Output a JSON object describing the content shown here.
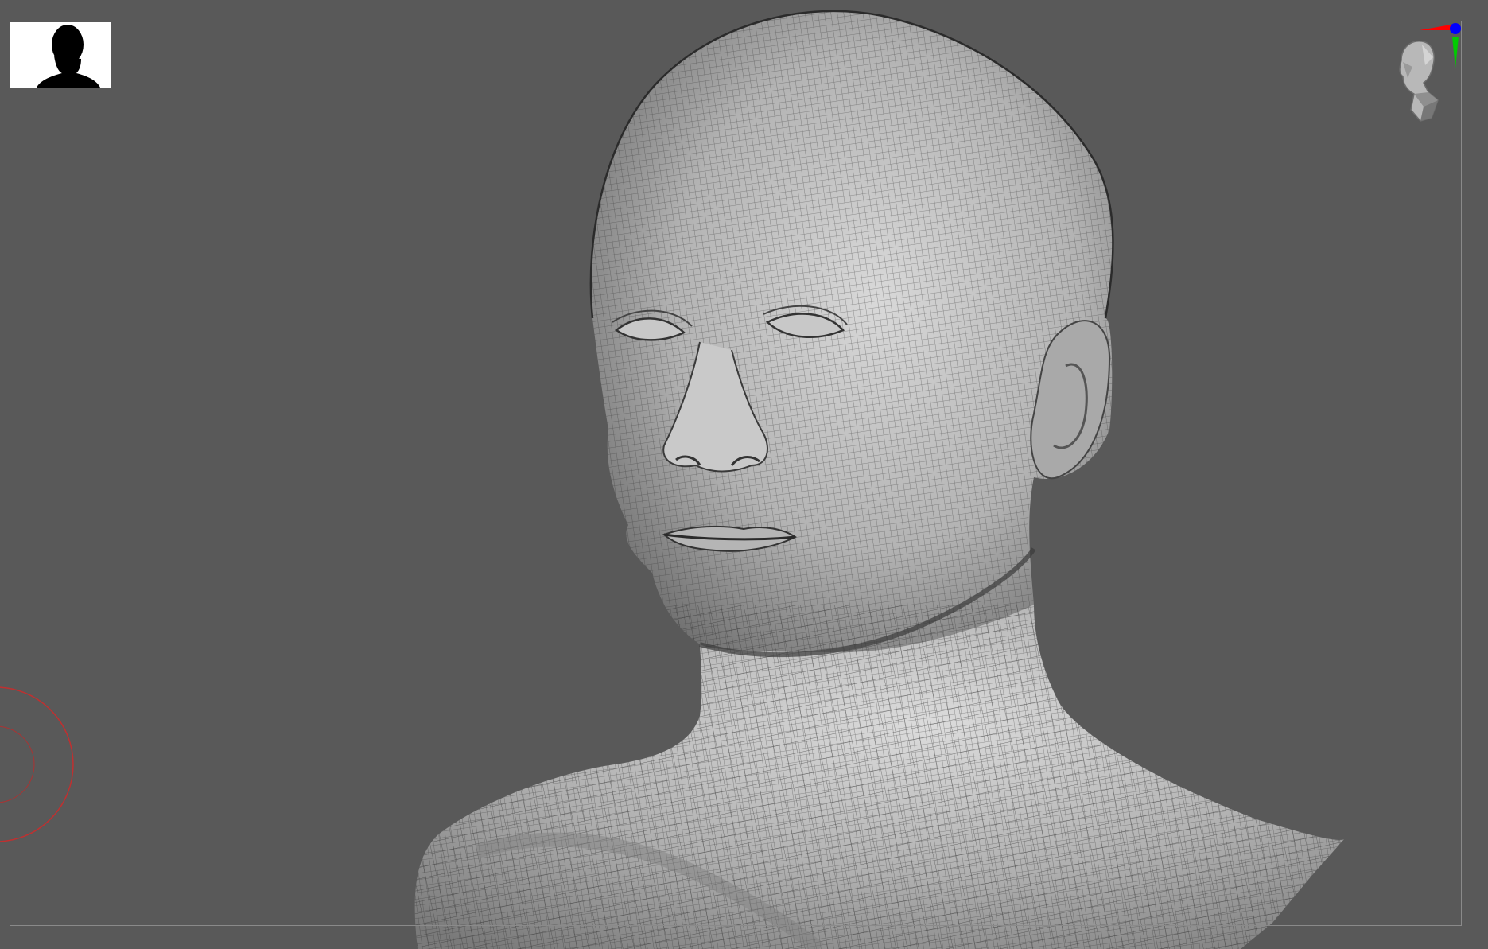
{
  "viewport": {
    "background_color": "#595959",
    "frame_border_color": "#8a8a8a",
    "mesh_fill_color": "#bdbdbd",
    "wire_color": "#3a3a3a"
  },
  "thumbnail": {
    "icon": "head-silhouette-icon",
    "background_color": "#ffffff",
    "silhouette_color": "#000000"
  },
  "navigation_gizmo": {
    "icon": "head-orientation-icon",
    "x_axis_color": "#ff0000",
    "y_axis_color": "#00cc00",
    "z_axis_color": "#0000ff"
  },
  "brush_cursor": {
    "icon": "brush-cursor-circles",
    "color": "#c03030"
  },
  "model": {
    "icon": "human-head-bust-wireframe"
  }
}
